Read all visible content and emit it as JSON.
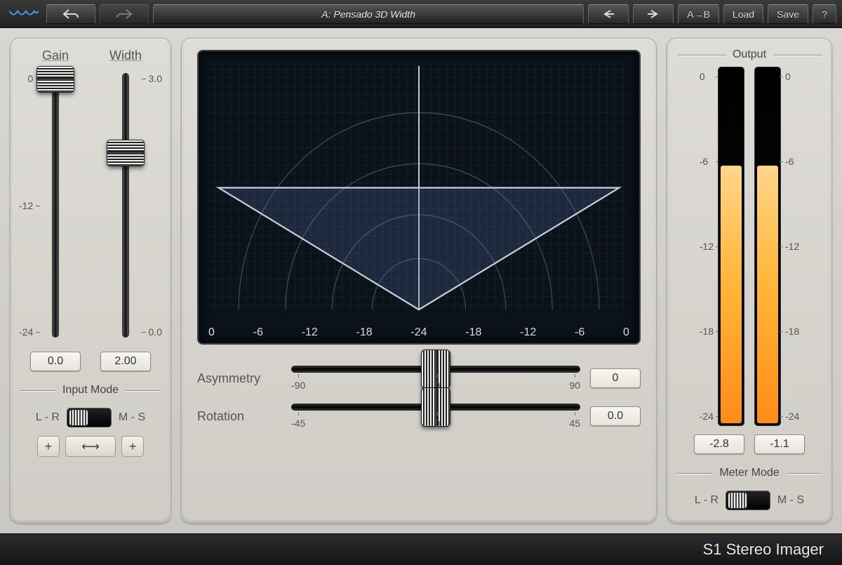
{
  "toolbar": {
    "preset_label": "A: Pensado 3D Width",
    "ab_label": "A→B",
    "load_label": "Load",
    "save_label": "Save",
    "help_label": "?"
  },
  "left": {
    "gain": {
      "label": "Gain",
      "scale": [
        "0",
        "-12",
        "-24"
      ],
      "value": "0.0",
      "pos_pct": 2
    },
    "width": {
      "label": "Width",
      "scale": [
        "3.0",
        "0.0"
      ],
      "value": "2.00",
      "pos_pct": 30
    },
    "input_mode": {
      "title": "Input Mode",
      "left": "L - R",
      "right": "M - S"
    },
    "buttons": {
      "plus_l": "+",
      "swap": "⟷",
      "plus_r": "+"
    }
  },
  "center": {
    "scope_axis": [
      "0",
      "-6",
      "-12",
      "-18",
      "-24",
      "-18",
      "-12",
      "-6",
      "0"
    ],
    "asymmetry": {
      "label": "Asymmetry",
      "scale": [
        "-90",
        "0",
        "90"
      ],
      "value": "0",
      "pos_pct": 50
    },
    "rotation": {
      "label": "Rotation",
      "scale": [
        "-45",
        "0",
        "45"
      ],
      "value": "0.0",
      "pos_pct": 50
    }
  },
  "right": {
    "title": "Output",
    "scale": [
      "0",
      "-6",
      "-12",
      "-18",
      "-24"
    ],
    "meter_l": {
      "fill_pct": 72,
      "peak": "-2.8"
    },
    "meter_r": {
      "fill_pct": 72,
      "peak": "-1.1"
    },
    "meter_mode": {
      "title": "Meter Mode",
      "left": "L - R",
      "right": "M - S"
    }
  },
  "footer": {
    "title": "S1 Stereo Imager"
  }
}
